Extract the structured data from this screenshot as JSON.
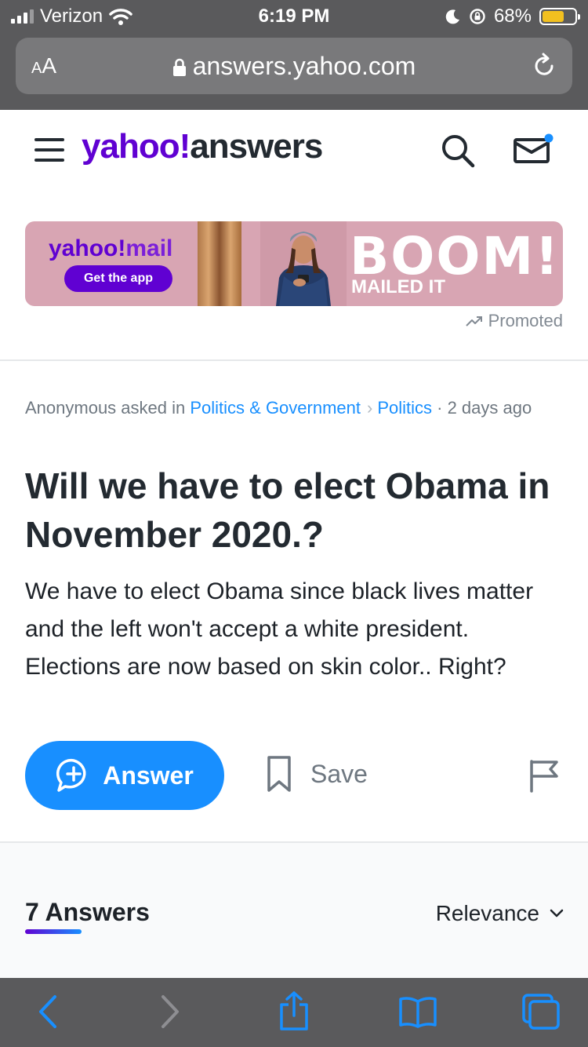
{
  "status_bar": {
    "carrier": "Verizon",
    "time": "6:19 PM",
    "battery_percent": "68%",
    "battery_level": 0.68
  },
  "browser": {
    "text_size_label_small": "A",
    "text_size_label_large": "A",
    "url": "answers.yahoo.com"
  },
  "header": {
    "logo_brand": "yahoo!",
    "logo_product": "answers"
  },
  "ad": {
    "brand": "yahoo!",
    "product": "mail",
    "cta": "Get the app",
    "headline": "BOOM!",
    "subline": "MAILED IT",
    "promoted_label": "Promoted"
  },
  "question": {
    "asker": "Anonymous asked in",
    "category": "Politics & Government",
    "subcategory": "Politics",
    "age": "· 2 days ago",
    "title": "Will we have to elect Obama in November 2020.?",
    "body": "We have to elect Obama since black lives matter and the left won't accept a white president.  Elections are now based on skin color.. Right?"
  },
  "actions": {
    "answer_label": "Answer",
    "save_label": "Save"
  },
  "answers": {
    "count_label": "7 Answers",
    "sort_label": "Relevance"
  },
  "colors": {
    "yahoo_purple": "#6001d2",
    "link_blue": "#188fff",
    "safari_chrome": "#5a5a5c"
  }
}
